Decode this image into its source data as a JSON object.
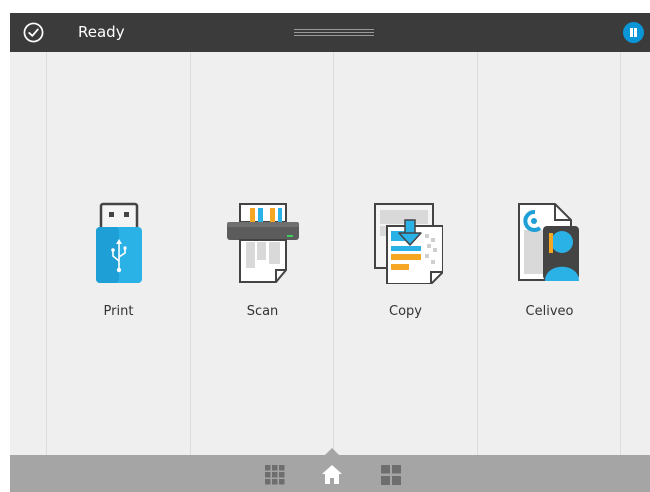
{
  "status": {
    "text": "Ready",
    "icon": "check-circle-icon"
  },
  "header": {
    "handle_icon": "drag-handle-icon",
    "pause_icon": "pause-icon",
    "pause_color": "#0a96d6"
  },
  "apps": [
    {
      "label": "Print",
      "icon": "usb-drive-icon"
    },
    {
      "label": "Scan",
      "icon": "scanner-icon"
    },
    {
      "label": "Copy",
      "icon": "copy-icon"
    },
    {
      "label": "Celiveo",
      "icon": "celiveo-icon"
    }
  ],
  "nav": {
    "items": [
      {
        "icon": "apps-grid-icon"
      },
      {
        "icon": "home-icon",
        "active": true
      },
      {
        "icon": "tiles-icon"
      }
    ]
  },
  "colors": {
    "topbar": "#3b3b3b",
    "background": "#efefef",
    "bottombar": "#a5a5a5",
    "accent_blue": "#0a96d6",
    "accent_orange": "#f5a623"
  }
}
